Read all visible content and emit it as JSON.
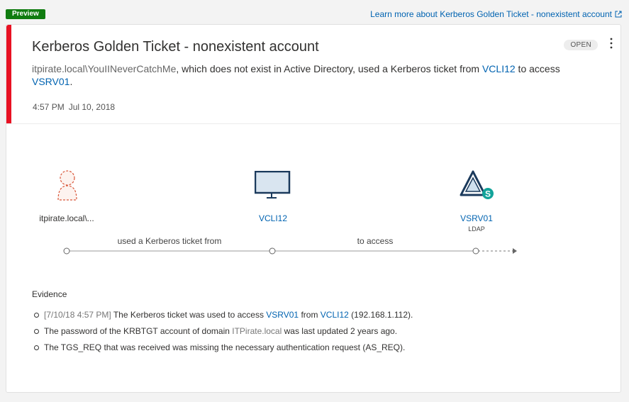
{
  "header": {
    "preview_label": "Preview",
    "learn_more_text": "Learn more about Kerberos Golden Ticket - nonexistent account",
    "learn_more_icon": "external-link-icon"
  },
  "alert": {
    "title": "Kerberos Golden Ticket - nonexistent account",
    "status": "OPEN",
    "severity_color": "#e81123",
    "description": {
      "account": "itpirate.local\\YouIINeverCatchMe",
      "text1": ", which does not exist in Active Directory, used a Kerberos ticket from ",
      "source": "VCLI12",
      "text2": " to access ",
      "target": "VSRV01",
      "text3": "."
    },
    "time": "4:57 PM",
    "date": "Jul 10, 2018"
  },
  "diagram": {
    "nodes": [
      {
        "label": "itpirate.local\\...",
        "icon": "unknown-user-icon"
      },
      {
        "label": "VCLI12",
        "icon": "monitor-icon"
      },
      {
        "label": "VSRV01",
        "sublabel": "LDAP",
        "icon": "domain-controller-icon"
      }
    ],
    "edges": [
      {
        "label": "used a Kerberos ticket from"
      },
      {
        "label": "to access"
      }
    ]
  },
  "evidence": {
    "title": "Evidence",
    "items": [
      {
        "timestamp": "[7/10/18 4:57 PM]",
        "t1": " The Kerberos ticket was used to access ",
        "l1": "VSRV01",
        "t2": " from ",
        "l2": "VCLI12",
        "t3": " (192.168.1.112)."
      },
      {
        "t1": "The password of the KRBTGT account of domain ",
        "m1": "ITPirate.local",
        "t2": " was last updated 2 years ago."
      },
      {
        "t1": "The TGS_REQ that was received was missing the necessary authentication request (AS_REQ)."
      }
    ]
  }
}
